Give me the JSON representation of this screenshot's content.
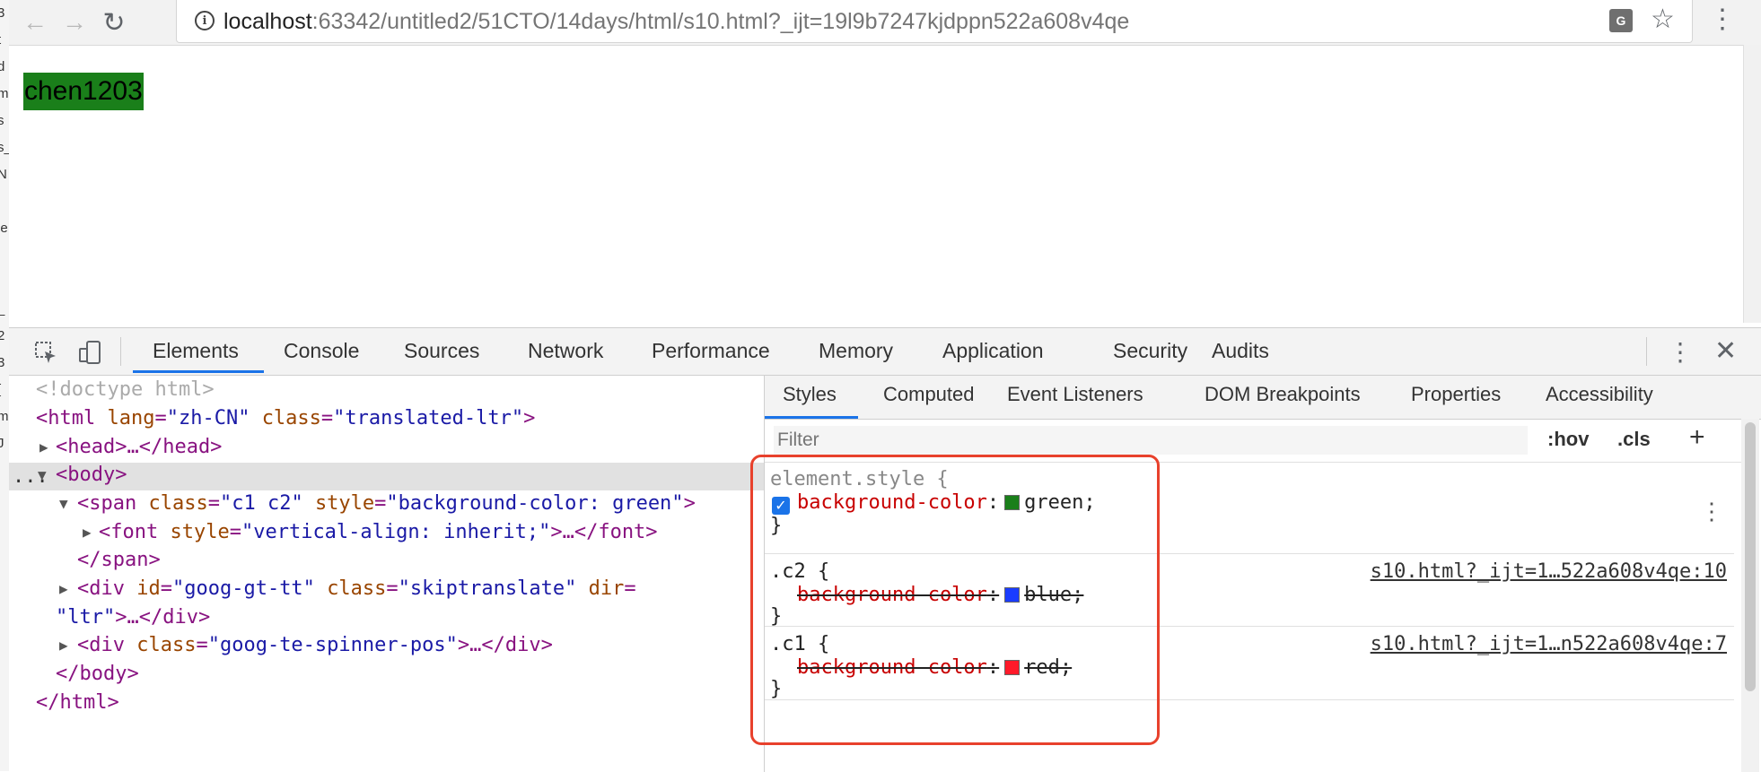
{
  "edge_glyphs": [
    "3",
    "t",
    "d",
    "m",
    "s",
    "s_",
    "N",
    "l",
    "le",
    "I",
    "l",
    "_",
    "2",
    "3",
    "[",
    "m",
    "J"
  ],
  "browser": {
    "url_host": "localhost",
    "url_rest": ":63342/untitled2/51CTO/14days/html/s10.html?_ijt=19l9b7247kjdppn522a608v4qe"
  },
  "page": {
    "rendered_text": "chen1203",
    "highlight_color": "#1a7f1a"
  },
  "devtools": {
    "tabs": [
      "Elements",
      "Console",
      "Sources",
      "Network",
      "Performance",
      "Memory",
      "Application",
      "Security",
      "Audits"
    ],
    "selected_tab": "Elements",
    "dom": {
      "doctype": "<!doctype html>",
      "html_open": "<html",
      "html_lang_attr": "lang",
      "html_lang_val": "\"zh-CN\"",
      "html_class_attr": "class",
      "html_class_val": "\"translated-ltr\"",
      "html_close_bracket": ">",
      "head": "<head>…</head>",
      "body_open": "<body>",
      "span_open": "<span",
      "span_class_attr": "class",
      "span_class_val": "\"c1 c2\"",
      "span_style_attr": "style",
      "span_style_val": "\"background-color: green\"",
      "span_close_bracket": ">",
      "font_open": "<font",
      "font_style_attr": "style",
      "font_style_val": "\"vertical-align: inherit;\"",
      "font_rest": ">…</font>",
      "span_close": "</span>",
      "div1_open": "<div",
      "div1_id_attr": "id",
      "div1_id_val": "\"goog-gt-tt\"",
      "div1_class_attr": "class",
      "div1_class_val": "\"skiptranslate\"",
      "div1_dir_attr": "dir",
      "div1_dir_val": "\"ltr\"",
      "div1_rest": ">…</div>",
      "div2_open": "<div",
      "div2_class_attr": "class",
      "div2_class_val": "\"goog-te-spinner-pos\"",
      "div2_rest": ">…</div>",
      "body_close": "</body>",
      "html_close": "</html>",
      "selected_marker": "..."
    },
    "styles": {
      "tabs": [
        "Styles",
        "Computed",
        "Event Listeners",
        "DOM Breakpoints",
        "Properties",
        "Accessibility"
      ],
      "filter_placeholder": "Filter",
      "hov": ":hov",
      "cls": ".cls",
      "rules": [
        {
          "selector": "element.style {",
          "prop": "background-color",
          "value": "green;",
          "swatch": "#1a7f1a",
          "source": "",
          "close": "}"
        },
        {
          "selector": ".c2 {",
          "prop": "background-color",
          "value": "blue;",
          "swatch": "#1a3cff",
          "source": "s10.html?_ijt=1…522a608v4qe:10",
          "close": "}"
        },
        {
          "selector": ".c1 {",
          "prop": "background-color",
          "value": "red;",
          "swatch": "#ff1a2a",
          "source": "s10.html?_ijt=1…n522a608v4qe:7",
          "close": "}"
        }
      ]
    }
  },
  "annotation": {
    "color": "#e8412c"
  }
}
